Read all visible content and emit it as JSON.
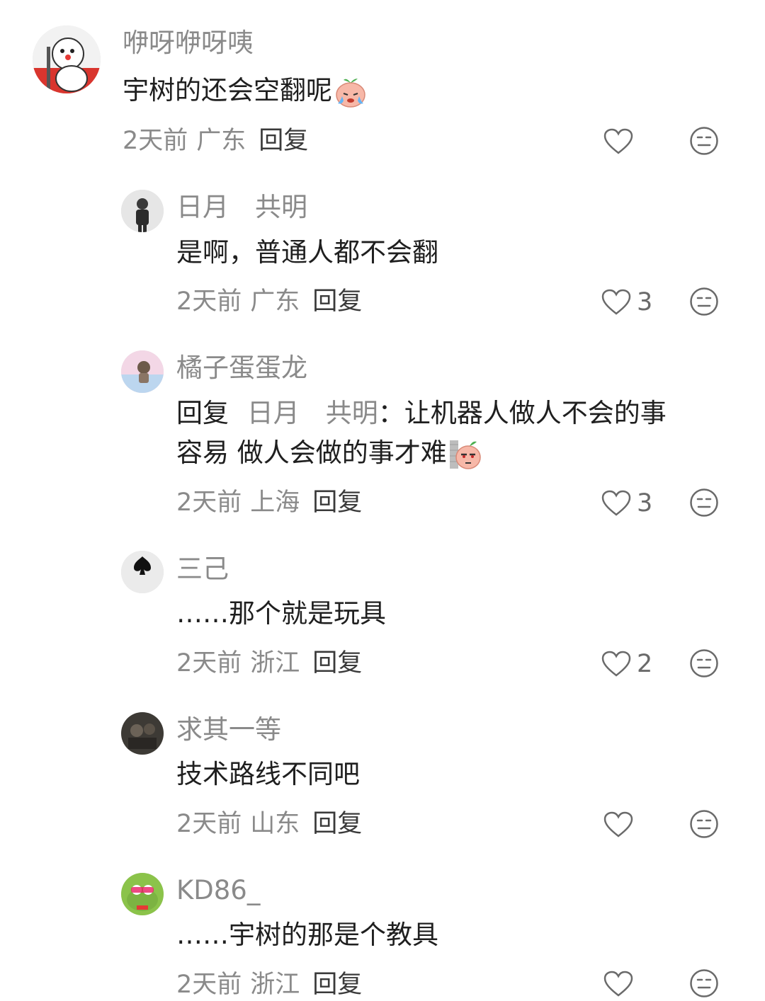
{
  "comments": [
    {
      "username": "咿呀咿呀咦",
      "text": "宇树的还会空翻呢",
      "time": "2天前",
      "location": "广东",
      "reply_label": "回复",
      "likes": "",
      "emoji": "crying-peach-emoji"
    },
    {
      "username": "日月　共明",
      "text": "是啊，普通人都不会翻",
      "time": "2天前",
      "location": "广东",
      "reply_label": "回复",
      "likes": "3"
    },
    {
      "username": "橘子蛋蛋龙",
      "reply_prefix": "回复",
      "reply_target": "日月　共明",
      "text_line1": "：让机器人做人不会的事",
      "text_line2": "容易 做人会做的事才难",
      "time": "2天前",
      "location": "上海",
      "reply_label": "回复",
      "likes": "3",
      "emoji": "peeking-peach-emoji"
    },
    {
      "username": "三己",
      "text": "……那个就是玩具",
      "time": "2天前",
      "location": "浙江",
      "reply_label": "回复",
      "likes": "2"
    },
    {
      "username": "求其一等",
      "text": "技术路线不同吧",
      "time": "2天前",
      "location": "山东",
      "reply_label": "回复",
      "likes": ""
    },
    {
      "username": "KD86_",
      "text": "……宇树的那是个教具",
      "time": "2天前",
      "location": "浙江",
      "reply_label": "回复",
      "likes": ""
    }
  ],
  "colors": {
    "username": "#8a8a8a",
    "text": "#1f1f1f",
    "icon": "#6a6a6a"
  }
}
